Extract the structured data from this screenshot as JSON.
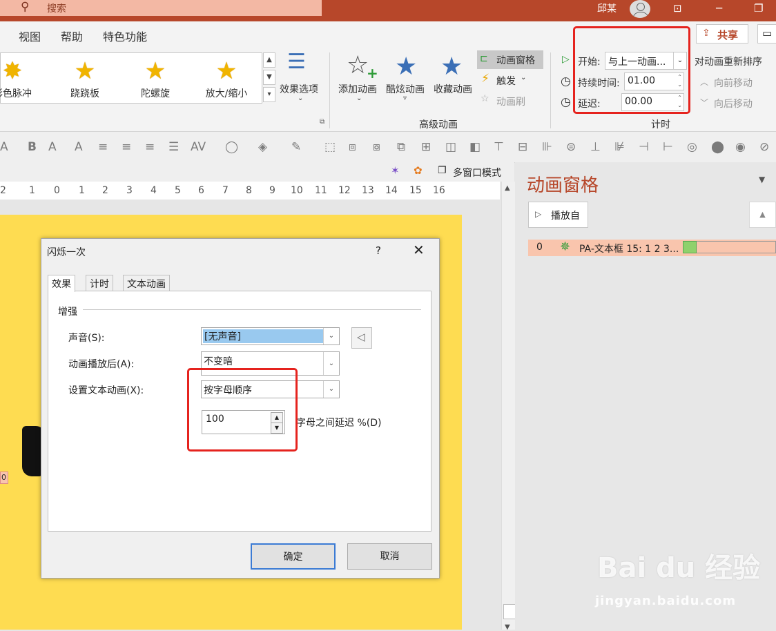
{
  "titlebar": {
    "search_placeholder": "搜索",
    "user_name": "邱某",
    "bg_color": "#b7472a"
  },
  "menu": {
    "items": [
      "视图",
      "帮助",
      "特色功能"
    ],
    "share_label": "共享"
  },
  "ribbon": {
    "gallery": [
      {
        "label": "彩色脉冲"
      },
      {
        "label": "跷跷板"
      },
      {
        "label": "陀螺旋"
      },
      {
        "label": "放大/缩小"
      }
    ],
    "effect_options_label": "效果选项",
    "advanced": {
      "add_animation": "添加动画",
      "cool_animation": "酷炫动画",
      "collect_animation": "收藏动画",
      "animation_pane": "动画窗格",
      "trigger": "触发",
      "animation_painter": "动画刷",
      "group_label": "高级动画"
    },
    "timing": {
      "start_label": "开始:",
      "start_value": "与上一动画...",
      "duration_label": "持续时间:",
      "duration_value": "01.00",
      "delay_label": "延迟:",
      "delay_value": "00.00",
      "reorder_label": "对动画重新排序",
      "move_earlier": "向前移动",
      "move_later": "向后移动",
      "group_label": "计时"
    }
  },
  "minibar": {
    "multiwindow_label": "多窗口模式"
  },
  "ruler": {
    "labels": [
      "2",
      "1",
      "0",
      "1",
      "2",
      "3",
      "4",
      "5",
      "6",
      "7",
      "8",
      "9",
      "10",
      "11",
      "12",
      "13",
      "14",
      "15",
      "16"
    ]
  },
  "pane": {
    "title": "动画窗格",
    "play_from": "播放自",
    "item": {
      "index": "0",
      "name": "PA-文本框 15: 1 2 3..."
    }
  },
  "dialog": {
    "title": "闪烁一次",
    "help": "?",
    "tabs": [
      "效果",
      "计时",
      "文本动画"
    ],
    "group_label": "增强",
    "sound_label": "声音(S):",
    "sound_value": "[无声音]",
    "after_anim_label": "动画播放后(A):",
    "after_anim_value": "不变暗",
    "text_anim_label": "设置文本动画(X):",
    "text_anim_value": "按字母顺序",
    "delay_value": "100",
    "delay_label": "字母之间延迟 %(D)",
    "ok": "确定",
    "cancel": "取消"
  },
  "slide": {
    "tag_text": "0",
    "bg_color": "#fedc51"
  },
  "watermark": {
    "brand": "Bai du 经验",
    "url": "jingyan.baidu.com"
  }
}
